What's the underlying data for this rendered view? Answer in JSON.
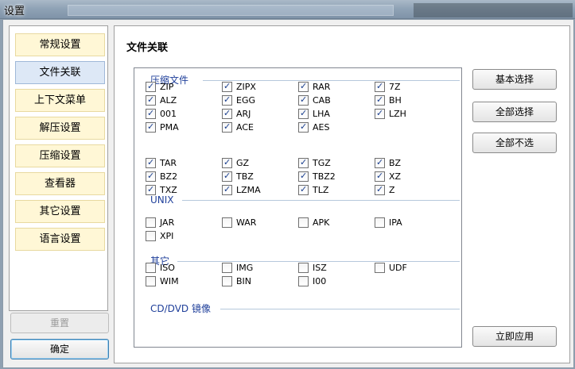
{
  "window": {
    "title": "设置"
  },
  "nav": {
    "items": [
      {
        "label": "常规设置",
        "active": false
      },
      {
        "label": "文件关联",
        "active": true
      },
      {
        "label": "上下文菜单",
        "active": false
      },
      {
        "label": "解压设置",
        "active": false
      },
      {
        "label": "压缩设置",
        "active": false
      },
      {
        "label": "查看器",
        "active": false
      },
      {
        "label": "其它设置",
        "active": false
      },
      {
        "label": "语言设置",
        "active": false
      }
    ],
    "reset_label": "重置",
    "ok_label": "确定"
  },
  "content": {
    "heading": "文件关联",
    "groups": [
      {
        "title": "压缩文件",
        "items": [
          {
            "label": "ZIP",
            "checked": true
          },
          {
            "label": "ZIPX",
            "checked": true
          },
          {
            "label": "RAR",
            "checked": true
          },
          {
            "label": "7Z",
            "checked": true
          },
          {
            "label": "ALZ",
            "checked": true
          },
          {
            "label": "EGG",
            "checked": true
          },
          {
            "label": "CAB",
            "checked": true
          },
          {
            "label": "BH",
            "checked": true
          },
          {
            "label": "001",
            "checked": true
          },
          {
            "label": "ARJ",
            "checked": true
          },
          {
            "label": "LHA",
            "checked": true
          },
          {
            "label": "LZH",
            "checked": true
          },
          {
            "label": "PMA",
            "checked": true
          },
          {
            "label": "ACE",
            "checked": true
          },
          {
            "label": "AES",
            "checked": true
          }
        ]
      },
      {
        "title": "UNIX",
        "items": [
          {
            "label": "TAR",
            "checked": true
          },
          {
            "label": "GZ",
            "checked": true
          },
          {
            "label": "TGZ",
            "checked": true
          },
          {
            "label": "BZ",
            "checked": true
          },
          {
            "label": "BZ2",
            "checked": true
          },
          {
            "label": "TBZ",
            "checked": true
          },
          {
            "label": "TBZ2",
            "checked": true
          },
          {
            "label": "XZ",
            "checked": true
          },
          {
            "label": "TXZ",
            "checked": true
          },
          {
            "label": "LZMA",
            "checked": true
          },
          {
            "label": "TLZ",
            "checked": true
          },
          {
            "label": "Z",
            "checked": true
          }
        ]
      },
      {
        "title": "其它",
        "items": [
          {
            "label": "JAR",
            "checked": false
          },
          {
            "label": "WAR",
            "checked": false
          },
          {
            "label": "APK",
            "checked": false
          },
          {
            "label": "IPA",
            "checked": false
          },
          {
            "label": "XPI",
            "checked": false
          }
        ]
      },
      {
        "title": "CD/DVD 镜像",
        "items": [
          {
            "label": "ISO",
            "checked": false
          },
          {
            "label": "IMG",
            "checked": false
          },
          {
            "label": "ISZ",
            "checked": false
          },
          {
            "label": "UDF",
            "checked": false
          },
          {
            "label": "WIM",
            "checked": false
          },
          {
            "label": "BIN",
            "checked": false
          },
          {
            "label": "I00",
            "checked": false
          }
        ]
      }
    ],
    "buttons": {
      "basic_label": "基本选择",
      "select_all_label": "全部选择",
      "select_none_label": "全部不选",
      "apply_label": "立即应用"
    }
  }
}
